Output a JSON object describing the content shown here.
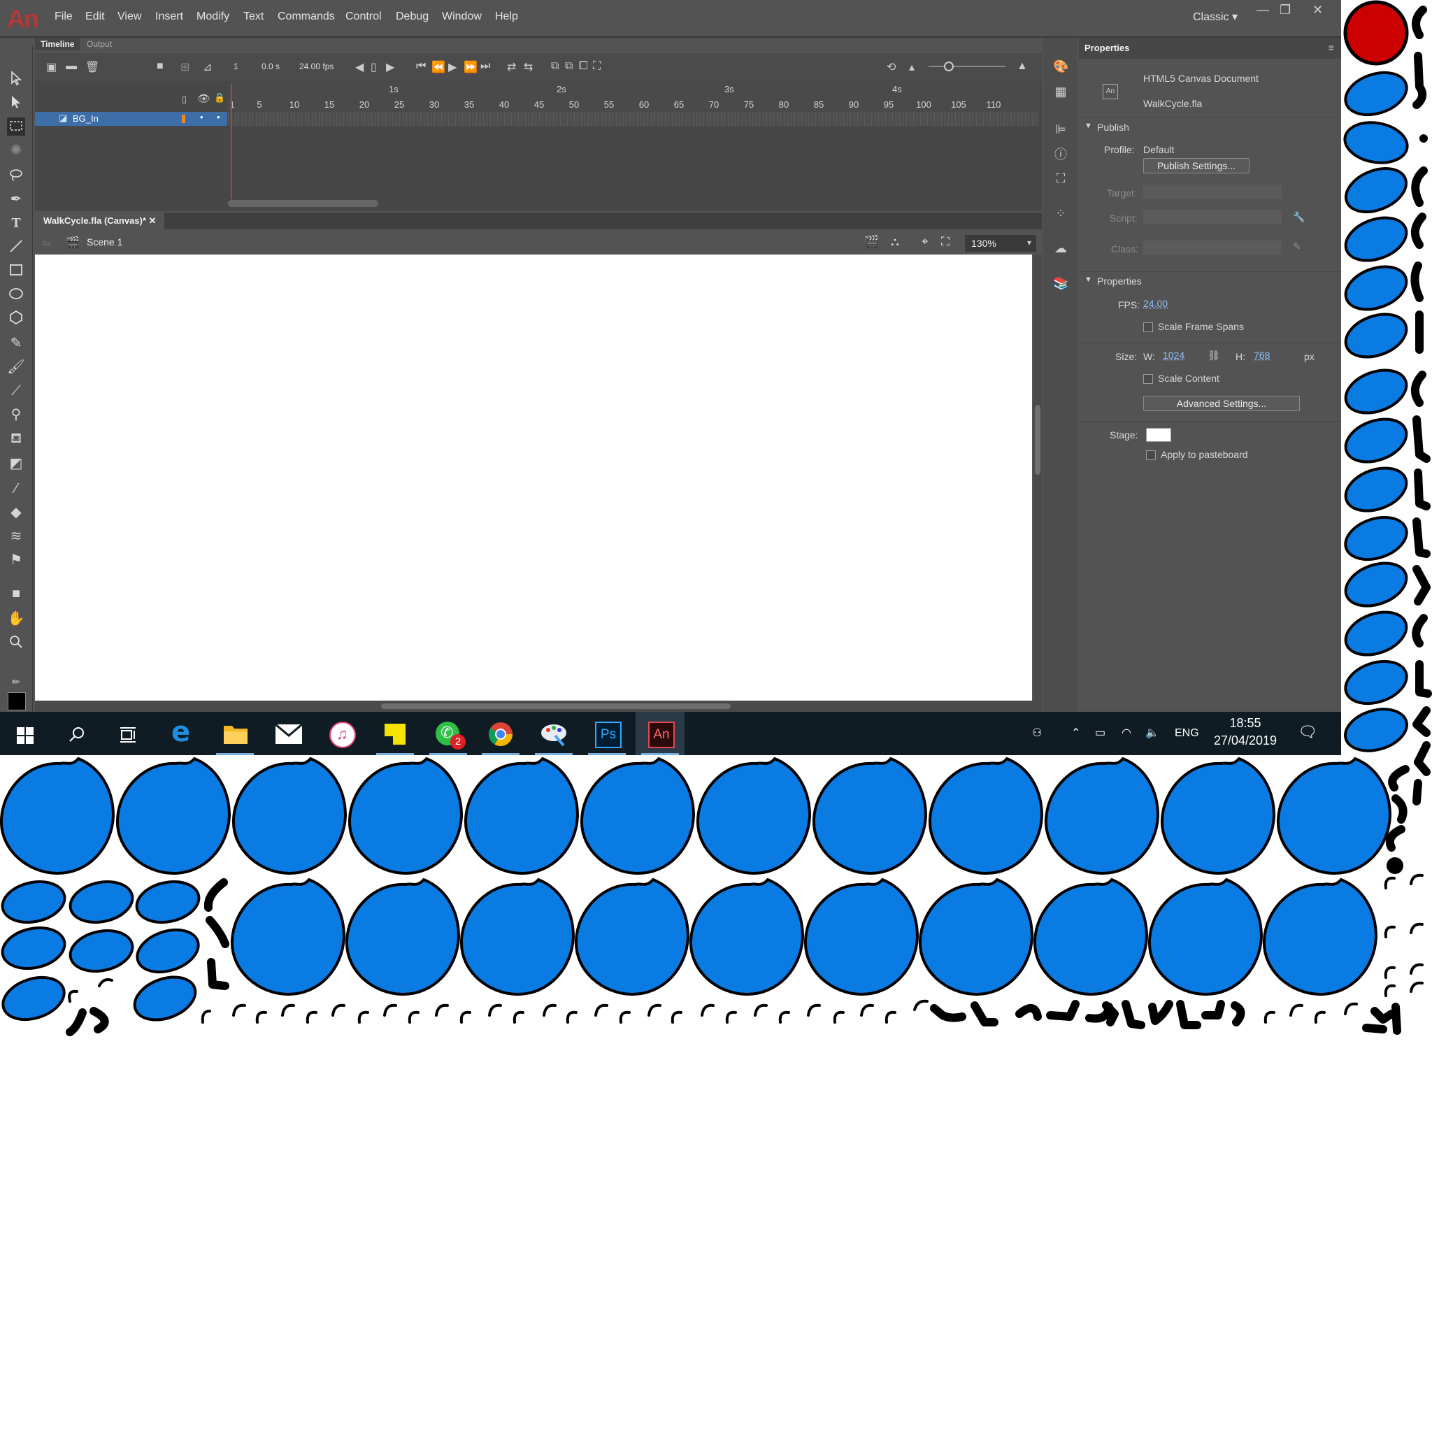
{
  "app": {
    "logo": "An",
    "menu": [
      "File",
      "Edit",
      "View",
      "Insert",
      "Modify",
      "Text",
      "Commands",
      "Control",
      "Debug",
      "Window",
      "Help"
    ],
    "workspace": "Classic",
    "window_controls": [
      "minimize",
      "restore",
      "close"
    ]
  },
  "timeline": {
    "tabs": [
      "Timeline",
      "Output"
    ],
    "current_frame": "1",
    "time": "0.0 s",
    "fps": "24.00 fps",
    "ruler_seconds": [
      "1s",
      "2s",
      "3s",
      "4s"
    ],
    "ruler_frames": [
      "1",
      "5",
      "10",
      "15",
      "20",
      "25",
      "30",
      "35",
      "40",
      "45",
      "50",
      "55",
      "60",
      "65",
      "70",
      "75",
      "80",
      "85",
      "90",
      "95",
      "100",
      "105",
      "110"
    ],
    "layers": [
      {
        "name": "BG_In",
        "selected": true
      }
    ]
  },
  "document": {
    "tab": "WalkCycle.fla (Canvas)*",
    "scene": "Scene 1",
    "zoom": "130%"
  },
  "properties": {
    "panel_title": "Properties",
    "doc_type": "HTML5 Canvas Document",
    "file": "WalkCycle.fla",
    "publish_section": "Publish",
    "profile_label": "Profile:",
    "profile_value": "Default",
    "publish_settings_button": "Publish Settings...",
    "target_label": "Target:",
    "script_label": "Script:",
    "class_label": "Class:",
    "properties_section": "Properties",
    "fps_label": "FPS:",
    "fps_value": "24.00",
    "scale_frame_spans": "Scale Frame Spans",
    "size_label": "Size:",
    "w_label": "W:",
    "w_value": "1024",
    "h_label": "H:",
    "h_value": "768",
    "unit": "px",
    "scale_content": "Scale Content",
    "advanced_settings_button": "Advanced Settings...",
    "stage_label": "Stage:",
    "stage_color": "#ffffff",
    "apply_to_pasteboard": "Apply to pasteboard"
  },
  "taskbar": {
    "apps": [
      "start",
      "search",
      "task-view",
      "edge",
      "file-explorer",
      "mail",
      "itunes",
      "sticky-notes",
      "whatsapp",
      "chrome",
      "paint",
      "photoshop",
      "animate"
    ],
    "whatsapp_badge": "2",
    "ps_label": "Ps",
    "an_label": "An",
    "language": "ENG",
    "time": "18:55",
    "date": "27/04/2019"
  },
  "colors": {
    "accent_blue": "#0a7be3",
    "red_circle": "#cc0000",
    "playhead": "#d83131",
    "ui_bg": "#535353"
  }
}
